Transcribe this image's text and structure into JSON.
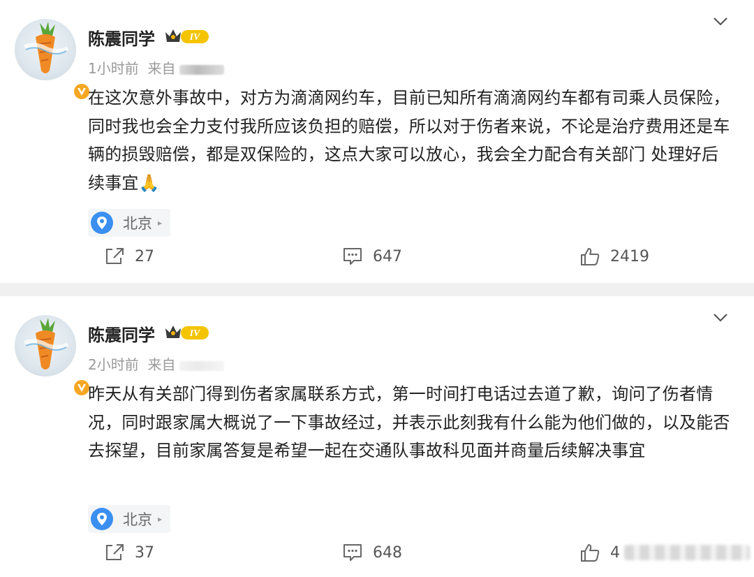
{
  "posts": [
    {
      "author": "陈震同学",
      "level": "IV",
      "time": "1小时前",
      "source_prefix": "来自",
      "content": "在这次意外事故中，对方为滴滴网约车，目前已知所有滴滴网约车都有司乘人员保险，同时我也会全力支付我所应该负担的赔偿，所以对于伤者来说，不论是治疗费用还是车辆的损毁赔偿，都是双保险的，这点大家可以放心，我会全力配合有关部门 处理好后续事宜🙏",
      "location": "北京",
      "reposts": "27",
      "comments": "647",
      "likes": "2419"
    },
    {
      "author": "陈震同学",
      "level": "IV",
      "time": "2小时前",
      "source_prefix": "来自",
      "content": "昨天从有关部门得到伤者家属联系方式，第一时间打电话过去道了歉，询问了伤者情况，同时跟家属大概说了一下事故经过，并表示此刻我有什么能为他们做的，以及能否去探望，目前家属答复是希望一起在交通队事故科见面并商量后续解决事宜",
      "location": "北京",
      "reposts": "37",
      "comments": "648",
      "likes": "4"
    }
  ],
  "icons": {
    "repost": "repost-icon",
    "comment": "comment-icon",
    "like": "like-icon",
    "location": "location-pin-icon",
    "menu": "chevron-down-icon",
    "verified": "verified-v-icon"
  },
  "colors": {
    "location_pin": "#3a8ff0",
    "verified": "#f5a623",
    "level_badge": "#f5b400",
    "divider": "#f0f0f0"
  }
}
